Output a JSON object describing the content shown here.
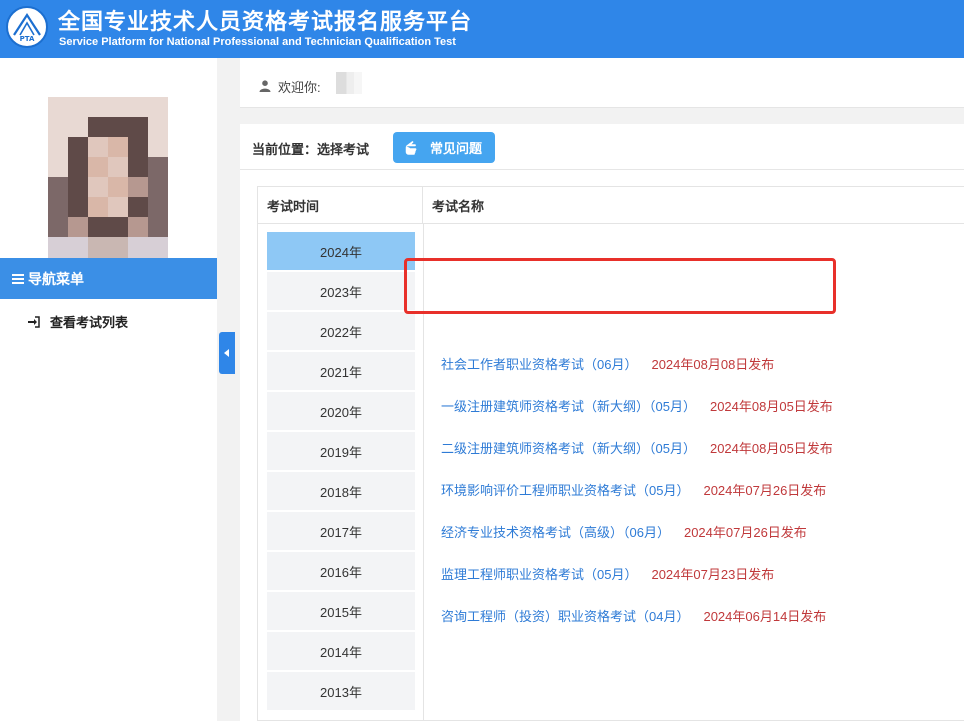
{
  "header": {
    "title": "全国专业技术人员资格考试报名服务平台",
    "subtitle": "Service Platform for National Professional and Technician Qualification Test",
    "logo_text": "PTA"
  },
  "welcome": {
    "label": "欢迎你:"
  },
  "sidebar": {
    "nav_title": "导航菜单",
    "items": [
      {
        "label": "查看考试列表",
        "icon": "sign-in-icon"
      }
    ]
  },
  "location": {
    "label": "当前位置：选择考试",
    "faq_button": "常见问题"
  },
  "table": {
    "col_time": "考试时间",
    "col_name": "考试名称",
    "years": [
      "2024年",
      "2023年",
      "2022年",
      "2021年",
      "2020年",
      "2019年",
      "2018年",
      "2017年",
      "2016年",
      "2015年",
      "2014年",
      "2013年"
    ],
    "selected_year": "2024年",
    "exams": [
      {
        "title": "社会工作者职业资格考试（06月）",
        "date": "2024年08月08日发布"
      },
      {
        "title": "一级注册建筑师资格考试（新大纲）（05月）",
        "date": "2024年08月05日发布"
      },
      {
        "title": "二级注册建筑师资格考试（新大纲）（05月）",
        "date": "2024年08月05日发布"
      },
      {
        "title": "环境影响评价工程师职业资格考试（05月）",
        "date": "2024年07月26日发布"
      },
      {
        "title": "经济专业技术资格考试（高级）（06月）",
        "date": "2024年07月26日发布"
      },
      {
        "title": "监理工程师职业资格考试（05月）",
        "date": "2024年07月23日发布"
      },
      {
        "title": "咨询工程师（投资）职业资格考试（04月）",
        "date": "2024年06月14日发布"
      }
    ]
  },
  "colors": {
    "header": "#2f86e8",
    "link": "#2e7bd6",
    "date": "#c0393b",
    "highlight": "#e8302a",
    "active_year": "#8ec8f5"
  }
}
